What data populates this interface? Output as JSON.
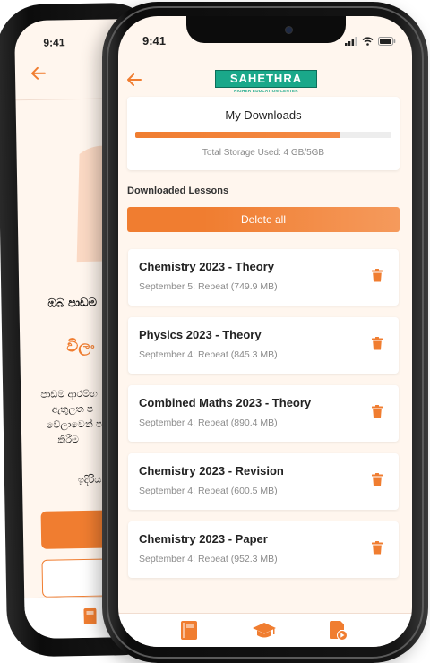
{
  "back_phone": {
    "status_time": "9:41",
    "line1": "ඔබ පාඩම",
    "title": "විලං",
    "paragraph": "පාඩම ආරම්භ\n    ඇතුලත ප\n  වේලාවෙන් ප\n      කිරීම",
    "short_text": "ඉදිරිය"
  },
  "front_phone": {
    "status_time": "9:41",
    "logo": {
      "main": "SAHETHRA",
      "sub": "HIGHER EDUCATION CENTER"
    },
    "storage": {
      "title": "My Downloads",
      "used_fraction": 0.8,
      "text": "Total Storage Used: 4 GB/5GB"
    },
    "section_label": "Downloaded Lessons",
    "delete_all_label": "Delete all",
    "lessons": [
      {
        "title": "Chemistry 2023 - Theory",
        "meta": "September 5: Repeat (749.9 MB)"
      },
      {
        "title": "Physics 2023 - Theory",
        "meta": "September 4: Repeat (845.3 MB)"
      },
      {
        "title": "Combined Maths 2023 - Theory",
        "meta": "September 4: Repeat (890.4 MB)"
      },
      {
        "title": "Chemistry 2023 - Revision",
        "meta": "September 4: Repeat (600.5 MB)"
      },
      {
        "title": "Chemistry 2023 - Paper",
        "meta": "September 4: Repeat (952.3 MB)"
      }
    ],
    "tabs": [
      {
        "icon": "book-icon"
      },
      {
        "icon": "graduation-cap-icon"
      },
      {
        "icon": "video-file-icon"
      }
    ]
  },
  "colors": {
    "accent": "#f07d30",
    "background": "#fff6ee",
    "logo": "#1aa88a"
  }
}
